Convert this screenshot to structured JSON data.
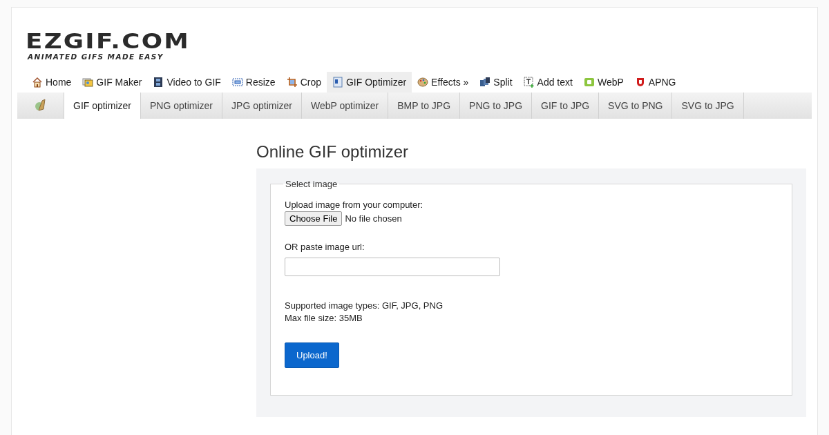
{
  "logo": {
    "name": "EZGIF.COM",
    "tagline": "ANIMATED GIFS MADE EASY"
  },
  "menu": [
    {
      "label": "Home",
      "selected": false
    },
    {
      "label": "GIF Maker",
      "selected": false
    },
    {
      "label": "Video to GIF",
      "selected": false
    },
    {
      "label": "Resize",
      "selected": false
    },
    {
      "label": "Crop",
      "selected": false
    },
    {
      "label": "GIF Optimizer",
      "selected": true
    },
    {
      "label": "Effects »",
      "selected": false
    },
    {
      "label": "Split",
      "selected": false
    },
    {
      "label": "Add text",
      "selected": false
    },
    {
      "label": "WebP",
      "selected": false
    },
    {
      "label": "APNG",
      "selected": false
    }
  ],
  "subtabs": [
    {
      "label": "GIF optimizer",
      "selected": true
    },
    {
      "label": "PNG optimizer",
      "selected": false
    },
    {
      "label": "JPG optimizer",
      "selected": false
    },
    {
      "label": "WebP optimizer",
      "selected": false
    },
    {
      "label": "BMP to JPG",
      "selected": false
    },
    {
      "label": "PNG to JPG",
      "selected": false
    },
    {
      "label": "GIF to JPG",
      "selected": false
    },
    {
      "label": "SVG to PNG",
      "selected": false
    },
    {
      "label": "SVG to JPG",
      "selected": false
    }
  ],
  "heading": "Online GIF optimizer",
  "form": {
    "legend": "Select image",
    "upload_label": "Upload image from your computer:",
    "file_button": "Choose File",
    "file_status": "No file chosen",
    "url_label": "OR paste image url:",
    "supported": "Supported image types: GIF, JPG, PNG",
    "max_size": "Max file size: 35MB",
    "submit": "Upload!"
  }
}
